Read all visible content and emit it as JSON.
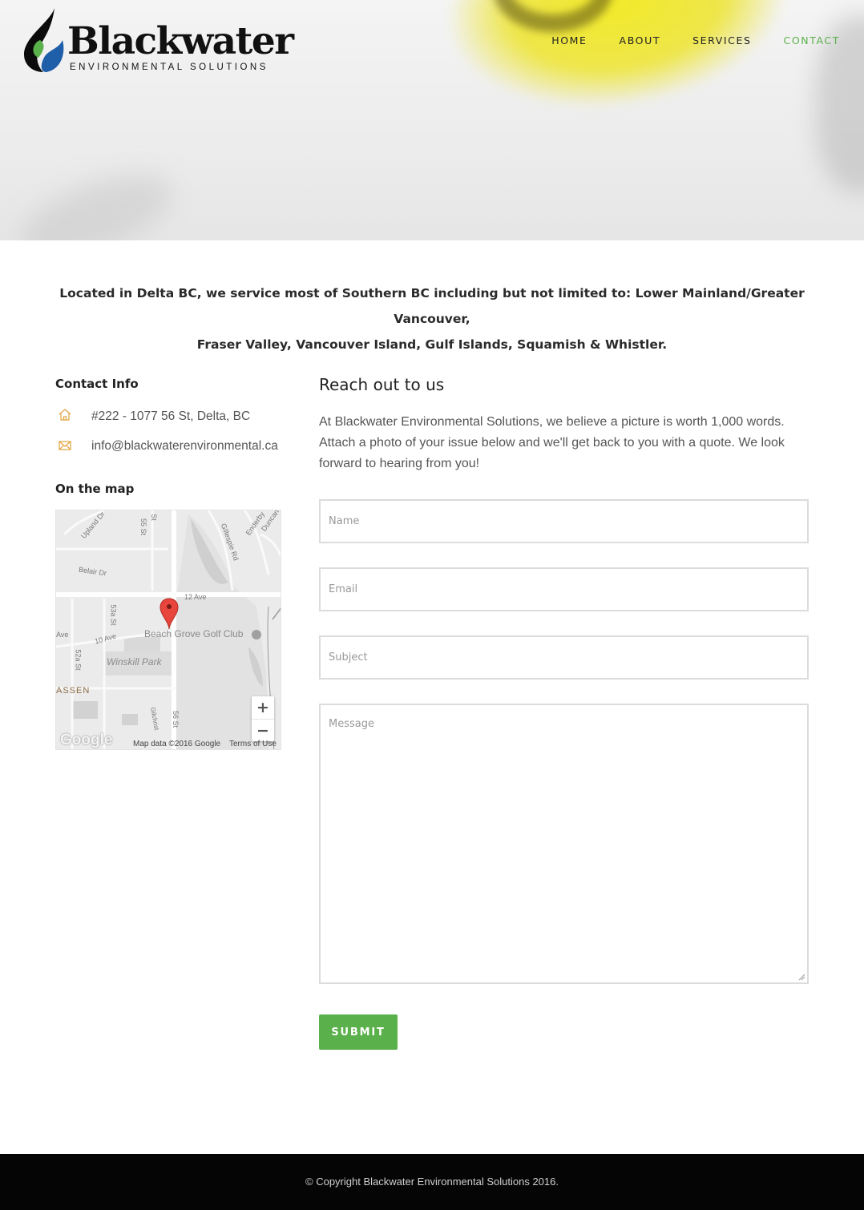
{
  "brand": {
    "name": "Blackwater",
    "tagline": "ENVIRONMENTAL SOLUTIONS",
    "colors": {
      "drop_dark": "#0b0b0b",
      "drop_green": "#5ab04a",
      "drop_blue": "#1f5faa"
    }
  },
  "nav": {
    "items": [
      {
        "label": "HOME",
        "active": false
      },
      {
        "label": "ABOUT",
        "active": false
      },
      {
        "label": "SERVICES",
        "active": false
      },
      {
        "label": "CONTACT",
        "active": true
      }
    ]
  },
  "intro": {
    "line1": "Located in Delta BC, we service most of Southern BC including but not limited to: Lower Mainland/Greater Vancouver,",
    "line2": "Fraser Valley, Vancouver Island, Gulf Islands, Squamish & Whistler."
  },
  "contact": {
    "title": "Contact Info",
    "address": "#222 - 1077 56 St, Delta, BC",
    "email": "info@blackwaterenvironmental.ca",
    "address_icon": "home-icon",
    "email_icon": "envelope-icon"
  },
  "map": {
    "title": "On the map",
    "labels": {
      "upland": "Upland Dr",
      "st55": "55 St",
      "st_top": "St",
      "gillespie": "Gillespie Rd",
      "enderby": "Enderby",
      "duncan": "Duncan",
      "belair": "Belair Dr",
      "ave12": "12 Ave",
      "st53a": "53a St",
      "ave10": "10 Ave",
      "ave_left": "Ave",
      "golf": "Beach Grove Golf Club",
      "winskill": "Winskill Park",
      "st52a": "52a St",
      "assen": "ASSEN",
      "gilchrist": "Gilchrist",
      "st56": "56 St"
    },
    "zoom_in": "+",
    "zoom_out": "−",
    "provider": "Google",
    "attribution": "Map data ©2016 Google",
    "terms": "Terms of Use"
  },
  "form": {
    "title": "Reach out to us",
    "description": "At Blackwater Environmental Solutions, we believe a picture is worth 1,000 words. Attach a photo of your issue below and we'll get back to you with a quote. We look forward to hearing from you!",
    "name_placeholder": "Name",
    "email_placeholder": "Email",
    "subject_placeholder": "Subject",
    "message_placeholder": "Message",
    "submit_label": "SUBMIT",
    "accent": "#5ab04a"
  },
  "footer": {
    "copyright": "© Copyright Blackwater Environmental Solutions 2016."
  }
}
